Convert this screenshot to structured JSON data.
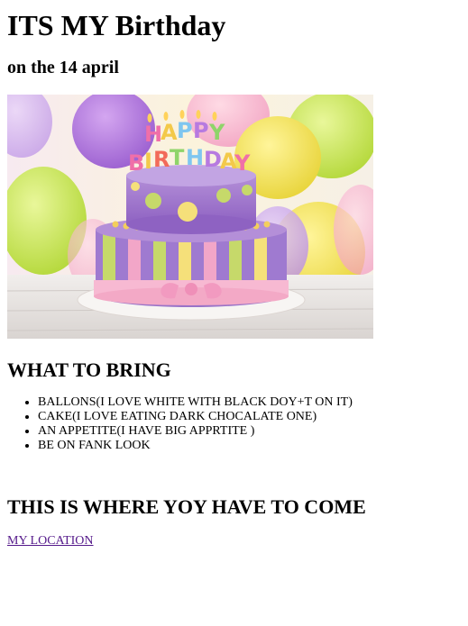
{
  "page": {
    "title": "ITS MY Birthday",
    "subtitle": "on the 14 april",
    "image": {
      "alt": "birthday-cake-photo",
      "cake_topper": [
        "HAPPY",
        "BIRTHDAY"
      ]
    },
    "bring": {
      "heading": "WHAT TO BRING",
      "items": [
        "BALLONS(I LOVE WHITE WITH BLACK DOY+T ON IT)",
        "CAKE(I LOVE EATING DARK CHOCALATE ONE)",
        "AN APPETITE(I HAVE BIG APPRTITE )",
        "BE ON FANK LOOK"
      ]
    },
    "location": {
      "heading": "THIS IS WHERE YOY HAVE TO COME",
      "link_label": "MY LOCATION"
    }
  }
}
